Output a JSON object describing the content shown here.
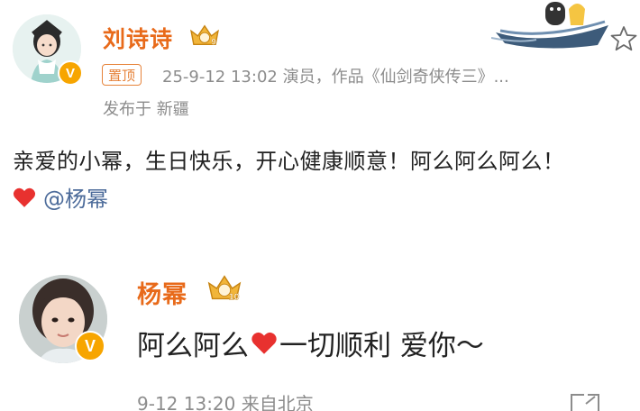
{
  "post": {
    "author": "刘诗诗",
    "badge_level": "9",
    "pinned_label": "置顶",
    "meta_line": "25-9-12 13:02  演员，作品《仙剑奇侠传三》...",
    "location_line": "发布于 新疆",
    "content": "亲爱的小幂，生日快乐，开心健康顺意！阿么阿么阿么！",
    "mention": "@杨幂",
    "verified_mark": "V"
  },
  "reply": {
    "author": "杨幂",
    "badge_level": "10",
    "text_part1": "阿么阿么",
    "text_part2": " 一切顺利 爱你～",
    "time_line": "9-12 13:20  来自北京",
    "verified_mark": "V"
  },
  "colors": {
    "name": "#e86a1a",
    "meta": "#8c8c8c",
    "mention": "#4c6b9a",
    "heart": "#e8312f",
    "verified": "#f7a500"
  },
  "icons": {
    "star": "star-icon",
    "heart": "heart-icon",
    "crown": "crown-icon",
    "boat": "boat-decoration-icon"
  }
}
